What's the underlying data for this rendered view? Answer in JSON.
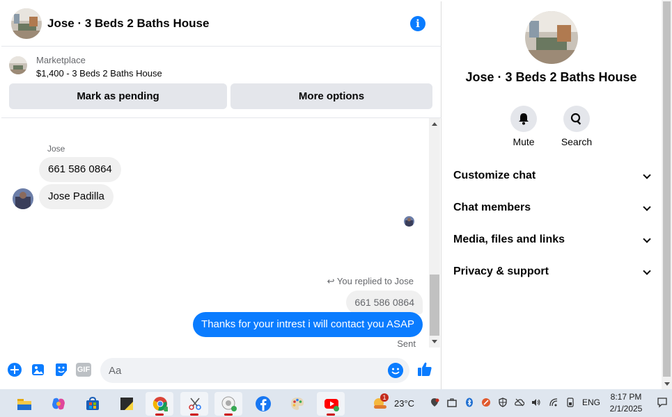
{
  "chat": {
    "title": "Jose · 3 Beds 2 Baths House",
    "marketplace": {
      "label": "Marketplace",
      "listing": "$1,400 - 3 Beds 2 Baths House"
    },
    "buttons": {
      "mark_pending": "Mark as pending",
      "more_options": "More options"
    },
    "messages": {
      "sender_name": "Jose",
      "incoming": [
        "661 586 0864",
        "Jose Padilla"
      ],
      "reply_note": "You replied to Jose",
      "reply_quote": "661 586 0864",
      "outgoing": "Thanks for your intrest i will contact you ASAP",
      "status": "Sent"
    },
    "composer": {
      "placeholder": "Aa",
      "gif_label": "GIF"
    }
  },
  "info": {
    "title": "Jose · 3 Beds 2 Baths House",
    "actions": [
      {
        "label": "Mute",
        "icon": "bell-icon"
      },
      {
        "label": "Search",
        "icon": "search-icon"
      }
    ],
    "sections": [
      "Customize chat",
      "Chat members",
      "Media, files and links",
      "Privacy & support"
    ]
  },
  "taskbar": {
    "apps": [
      "file-explorer",
      "copilot",
      "microsoft-store",
      "sticky-notes",
      "chrome",
      "snipping-tool",
      "messenger",
      "facebook",
      "paint",
      "youtube"
    ],
    "weather": {
      "temp": "23°C",
      "badge": "1"
    },
    "language": "ENG",
    "time": "8:17 PM",
    "date": "2/1/2025"
  },
  "colors": {
    "accent": "#0a7cff",
    "bubble_in": "#f0f0f0",
    "taskbar": "#dfe6ef"
  }
}
